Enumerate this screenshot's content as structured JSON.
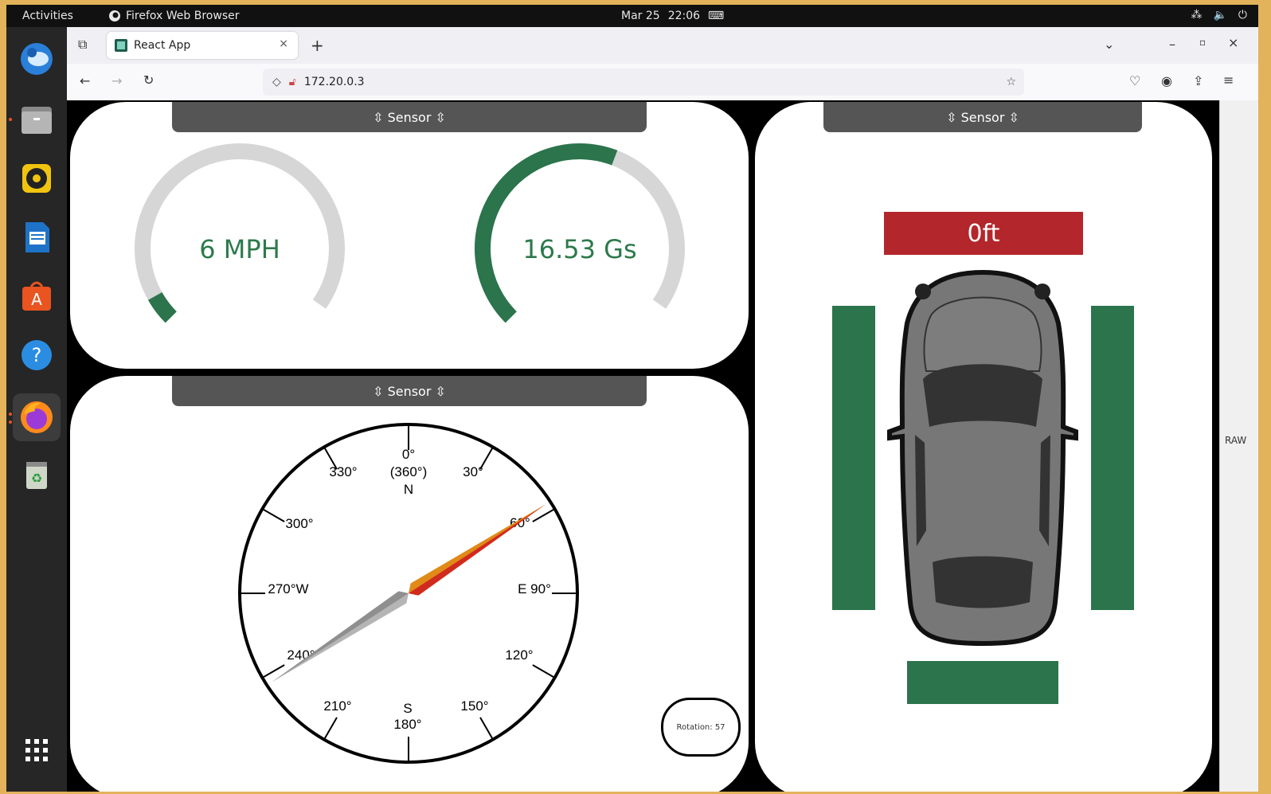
{
  "topbar": {
    "activities": "Activities",
    "app_name": "Firefox Web Browser",
    "date": "Mar 25",
    "time": "22:06"
  },
  "dock": {
    "items": [
      "thunderbird-icon",
      "files-icon",
      "rhythmbox-icon",
      "writer-icon",
      "software-icon",
      "help-icon",
      "firefox-icon",
      "trash-icon",
      "app-grid-icon"
    ]
  },
  "browser": {
    "tab_title": "React App",
    "url": "172.20.0.3"
  },
  "panels": {
    "header_label": "⇳ Sensor ⇳",
    "speed": {
      "label": "6 MPH",
      "fraction": 0.06
    },
    "gforce": {
      "label": "16.53 Gs",
      "fraction": 0.6
    },
    "compass": {
      "rotation_label": "Rotation: 57",
      "rotation_deg": 57,
      "labels": {
        "n": "0°",
        "n2": "(360°)",
        "n3": "N",
        "d30": "30°",
        "d60": "60°",
        "e": "E 90°",
        "d120": "120°",
        "d150": "150°",
        "s": "S",
        "s2": "180°",
        "d210": "210°",
        "d240": "240°",
        "w": "270°W",
        "d300": "300°",
        "d330": "330°"
      }
    },
    "parking": {
      "distance": "0ft"
    }
  },
  "raw_tab": "RAW",
  "colors": {
    "accent_green": "#2b744c",
    "alert_red": "#b3262b",
    "gauge_track": "#d6d6d6"
  }
}
